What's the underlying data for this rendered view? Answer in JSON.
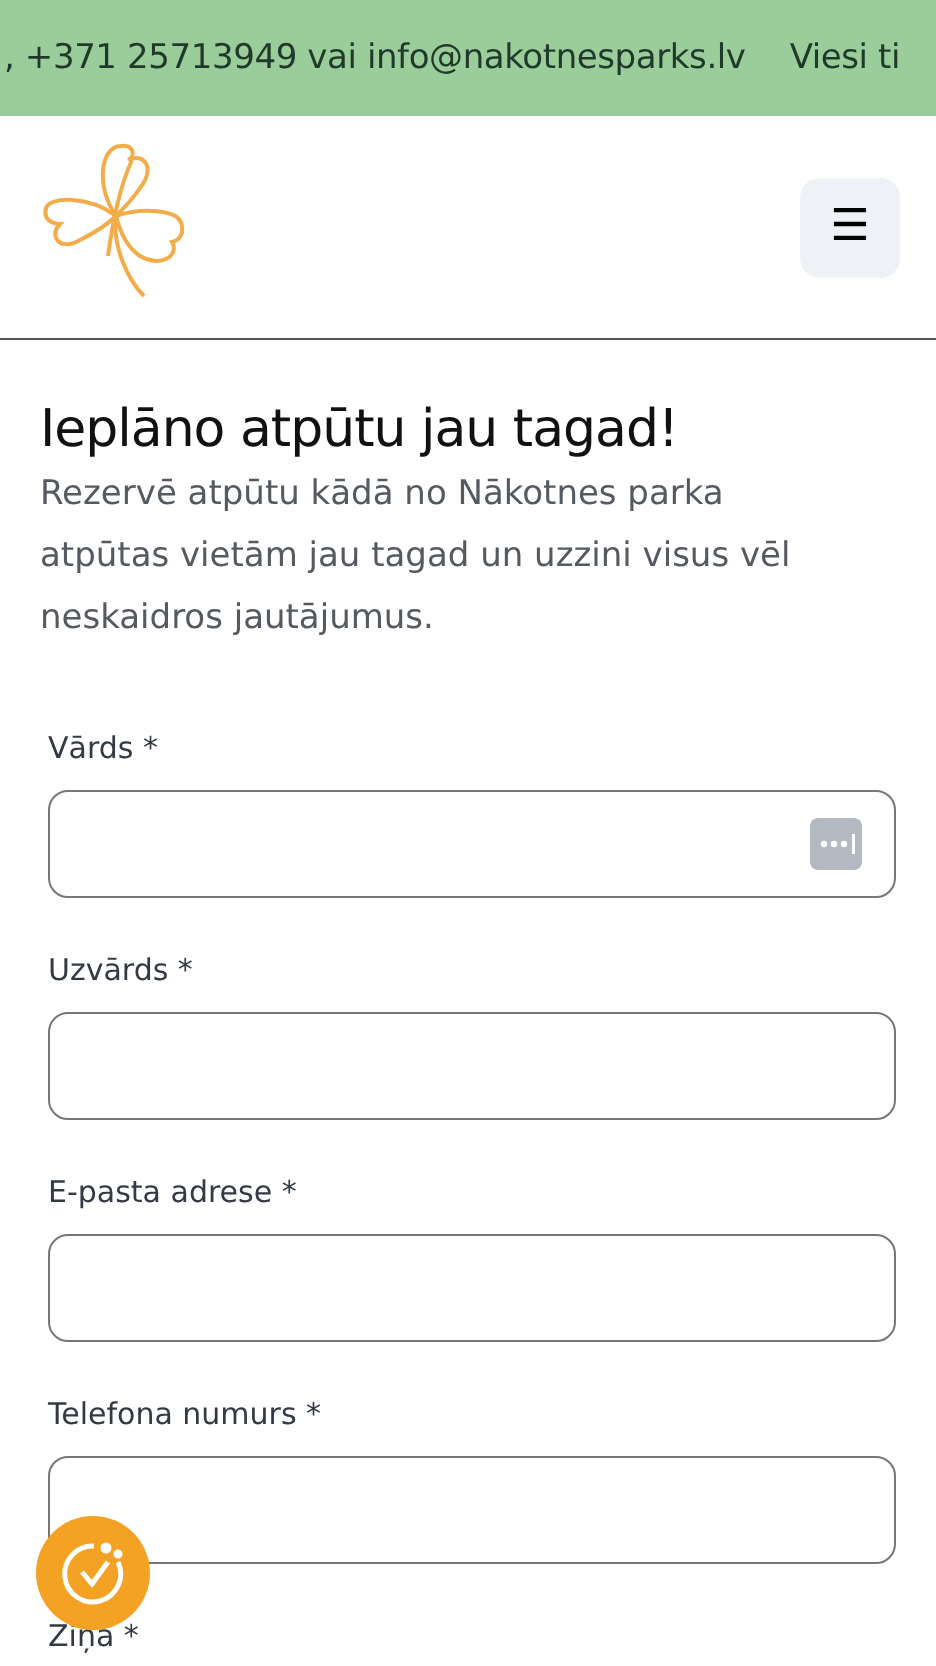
{
  "top_banner": {
    "texts": [
      ", +371 25713949 vai info@nakotnesparks.lv",
      "Viesi ti"
    ]
  },
  "header": {
    "menu_button": "☰"
  },
  "intro": {
    "heading": "Ieplāno atpūtu jau tagad!",
    "text": "Rezervē atpūtu kādā no Nākotnes parka atpūtas vietām jau tagad un uzzini visus vēl neskaidros jautājumus."
  },
  "form": {
    "fields": [
      {
        "kind": "input",
        "label": "Vārds *",
        "autofill": true
      },
      {
        "kind": "input",
        "label": "Uzvārds *",
        "autofill": false
      },
      {
        "kind": "input",
        "label": "E-pasta adrese *",
        "autofill": false
      },
      {
        "kind": "input",
        "label": "Telefona numurs *",
        "autofill": false
      },
      {
        "kind": "label",
        "label": "Ziņa *"
      }
    ]
  }
}
